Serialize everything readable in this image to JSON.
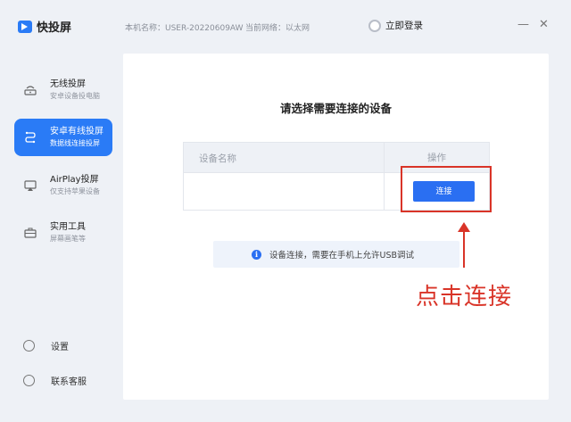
{
  "app": {
    "name": "快投屏",
    "machine_label": "本机名称：USER-20220609AW",
    "network_label": "当前网络：以太网",
    "login_label": "立即登录",
    "minimize_glyph": "—",
    "close_glyph": "✕"
  },
  "sidebar": {
    "items": [
      {
        "title": "无线投屏",
        "subtitle": "安卓设备投电脑",
        "icon": "wifi-screen-icon"
      },
      {
        "title": "安卓有线投屏",
        "subtitle": "数据线连接投屏",
        "icon": "usb-cable-icon",
        "active": true
      },
      {
        "title": "AirPlay投屏",
        "subtitle": "仅支持苹果设备",
        "icon": "airplay-icon"
      },
      {
        "title": "实用工具",
        "subtitle": "屏幕画笔等",
        "icon": "toolbox-icon"
      }
    ],
    "bottom": [
      {
        "label": "设置",
        "icon": "gear-icon"
      },
      {
        "label": "联系客服",
        "icon": "headset-icon"
      }
    ]
  },
  "main": {
    "title": "请选择需要连接的设备",
    "table": {
      "columns": [
        "设备名称",
        "操作"
      ],
      "button_label": "连接"
    },
    "info_text": "设备连接，需要在手机上允许USB调试"
  },
  "annotation": {
    "text": "点击连接",
    "color": "#d93428"
  },
  "colors": {
    "accent": "#2a7bf6",
    "button": "#2a6ff2",
    "highlight": "#d93428"
  }
}
